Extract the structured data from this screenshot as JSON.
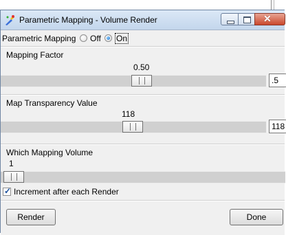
{
  "window": {
    "title": "Parametric Mapping - Volume Render",
    "close_glyph": "✕"
  },
  "parametric_mapping": {
    "label": "Parametric Mapping",
    "options": [
      {
        "label": "Off",
        "selected": false
      },
      {
        "label": "On",
        "selected": true
      }
    ]
  },
  "mapping_factor": {
    "title": "Mapping Factor",
    "value_label": "0.50",
    "value": 0.5,
    "input_value": ".5"
  },
  "map_transparency": {
    "title": "Map Transparency Value",
    "value_label": "118",
    "value": 118,
    "input_value": "118"
  },
  "mapping_volume": {
    "title": "Which Mapping Volume",
    "value_label": "1",
    "value": 1
  },
  "increment_checkbox": {
    "label": "Increment after each Render",
    "checked": true,
    "glyph": "✓"
  },
  "buttons": {
    "render": "Render",
    "done": "Done"
  },
  "colors": {
    "titlebar": "#c6d6ea",
    "close_button": "#c9472c",
    "radio_selected": "#1a6cc8"
  }
}
